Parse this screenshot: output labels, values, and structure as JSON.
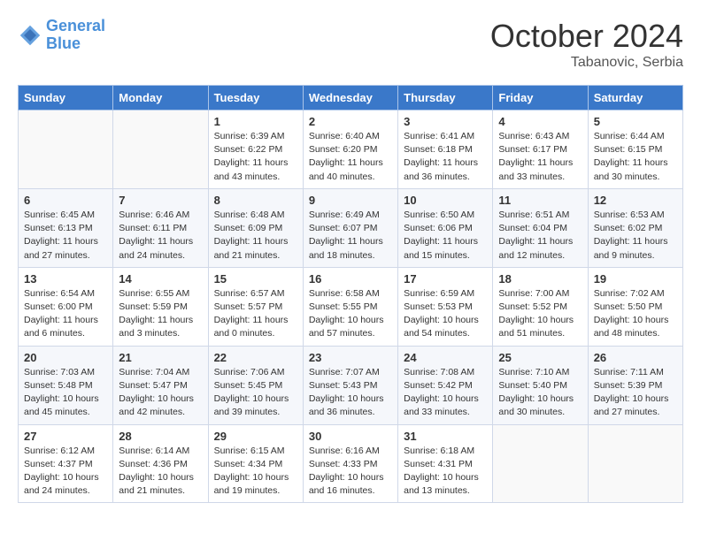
{
  "header": {
    "logo_line1": "General",
    "logo_line2": "Blue",
    "month": "October 2024",
    "location": "Tabanovic, Serbia"
  },
  "weekdays": [
    "Sunday",
    "Monday",
    "Tuesday",
    "Wednesday",
    "Thursday",
    "Friday",
    "Saturday"
  ],
  "weeks": [
    [
      {
        "day": "",
        "info": ""
      },
      {
        "day": "",
        "info": ""
      },
      {
        "day": "1",
        "info": "Sunrise: 6:39 AM\nSunset: 6:22 PM\nDaylight: 11 hours and 43 minutes."
      },
      {
        "day": "2",
        "info": "Sunrise: 6:40 AM\nSunset: 6:20 PM\nDaylight: 11 hours and 40 minutes."
      },
      {
        "day": "3",
        "info": "Sunrise: 6:41 AM\nSunset: 6:18 PM\nDaylight: 11 hours and 36 minutes."
      },
      {
        "day": "4",
        "info": "Sunrise: 6:43 AM\nSunset: 6:17 PM\nDaylight: 11 hours and 33 minutes."
      },
      {
        "day": "5",
        "info": "Sunrise: 6:44 AM\nSunset: 6:15 PM\nDaylight: 11 hours and 30 minutes."
      }
    ],
    [
      {
        "day": "6",
        "info": "Sunrise: 6:45 AM\nSunset: 6:13 PM\nDaylight: 11 hours and 27 minutes."
      },
      {
        "day": "7",
        "info": "Sunrise: 6:46 AM\nSunset: 6:11 PM\nDaylight: 11 hours and 24 minutes."
      },
      {
        "day": "8",
        "info": "Sunrise: 6:48 AM\nSunset: 6:09 PM\nDaylight: 11 hours and 21 minutes."
      },
      {
        "day": "9",
        "info": "Sunrise: 6:49 AM\nSunset: 6:07 PM\nDaylight: 11 hours and 18 minutes."
      },
      {
        "day": "10",
        "info": "Sunrise: 6:50 AM\nSunset: 6:06 PM\nDaylight: 11 hours and 15 minutes."
      },
      {
        "day": "11",
        "info": "Sunrise: 6:51 AM\nSunset: 6:04 PM\nDaylight: 11 hours and 12 minutes."
      },
      {
        "day": "12",
        "info": "Sunrise: 6:53 AM\nSunset: 6:02 PM\nDaylight: 11 hours and 9 minutes."
      }
    ],
    [
      {
        "day": "13",
        "info": "Sunrise: 6:54 AM\nSunset: 6:00 PM\nDaylight: 11 hours and 6 minutes."
      },
      {
        "day": "14",
        "info": "Sunrise: 6:55 AM\nSunset: 5:59 PM\nDaylight: 11 hours and 3 minutes."
      },
      {
        "day": "15",
        "info": "Sunrise: 6:57 AM\nSunset: 5:57 PM\nDaylight: 11 hours and 0 minutes."
      },
      {
        "day": "16",
        "info": "Sunrise: 6:58 AM\nSunset: 5:55 PM\nDaylight: 10 hours and 57 minutes."
      },
      {
        "day": "17",
        "info": "Sunrise: 6:59 AM\nSunset: 5:53 PM\nDaylight: 10 hours and 54 minutes."
      },
      {
        "day": "18",
        "info": "Sunrise: 7:00 AM\nSunset: 5:52 PM\nDaylight: 10 hours and 51 minutes."
      },
      {
        "day": "19",
        "info": "Sunrise: 7:02 AM\nSunset: 5:50 PM\nDaylight: 10 hours and 48 minutes."
      }
    ],
    [
      {
        "day": "20",
        "info": "Sunrise: 7:03 AM\nSunset: 5:48 PM\nDaylight: 10 hours and 45 minutes."
      },
      {
        "day": "21",
        "info": "Sunrise: 7:04 AM\nSunset: 5:47 PM\nDaylight: 10 hours and 42 minutes."
      },
      {
        "day": "22",
        "info": "Sunrise: 7:06 AM\nSunset: 5:45 PM\nDaylight: 10 hours and 39 minutes."
      },
      {
        "day": "23",
        "info": "Sunrise: 7:07 AM\nSunset: 5:43 PM\nDaylight: 10 hours and 36 minutes."
      },
      {
        "day": "24",
        "info": "Sunrise: 7:08 AM\nSunset: 5:42 PM\nDaylight: 10 hours and 33 minutes."
      },
      {
        "day": "25",
        "info": "Sunrise: 7:10 AM\nSunset: 5:40 PM\nDaylight: 10 hours and 30 minutes."
      },
      {
        "day": "26",
        "info": "Sunrise: 7:11 AM\nSunset: 5:39 PM\nDaylight: 10 hours and 27 minutes."
      }
    ],
    [
      {
        "day": "27",
        "info": "Sunrise: 6:12 AM\nSunset: 4:37 PM\nDaylight: 10 hours and 24 minutes."
      },
      {
        "day": "28",
        "info": "Sunrise: 6:14 AM\nSunset: 4:36 PM\nDaylight: 10 hours and 21 minutes."
      },
      {
        "day": "29",
        "info": "Sunrise: 6:15 AM\nSunset: 4:34 PM\nDaylight: 10 hours and 19 minutes."
      },
      {
        "day": "30",
        "info": "Sunrise: 6:16 AM\nSunset: 4:33 PM\nDaylight: 10 hours and 16 minutes."
      },
      {
        "day": "31",
        "info": "Sunrise: 6:18 AM\nSunset: 4:31 PM\nDaylight: 10 hours and 13 minutes."
      },
      {
        "day": "",
        "info": ""
      },
      {
        "day": "",
        "info": ""
      }
    ]
  ]
}
